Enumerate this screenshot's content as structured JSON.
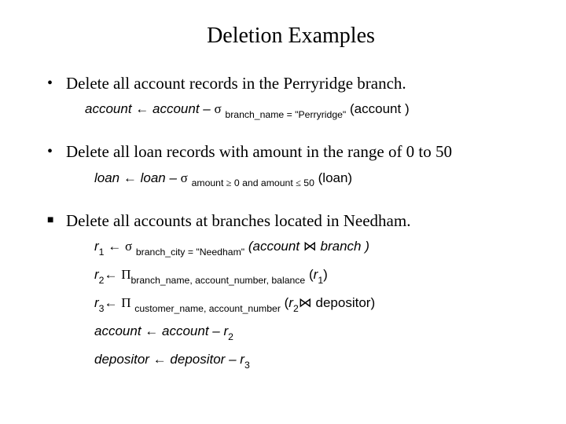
{
  "title": "Deletion Examples",
  "items": [
    {
      "bullet": "•",
      "text": "Delete all account records in the Perryridge branch.",
      "formula": {
        "lhs": "account",
        "arrow": "←",
        "rhs_a": "account –",
        "sigma": "σ",
        "sub": "branch_name = \"Perryridge\"",
        "tail": "(account )"
      }
    },
    {
      "bullet": "•",
      "text": "Delete all loan records with amount in the range of 0 to 50",
      "formula": {
        "lhs": "loan",
        "arrow": "←",
        "rhs_a": "loan –",
        "sigma": "σ",
        "sub_a": "amount",
        "ge": "≥",
        "sub_b": "0 and amount",
        "le": "≤",
        "sub_c": "50",
        "tail": "(loan)"
      }
    },
    {
      "bullet": "■",
      "text": "Delete all accounts at branches located in Needham.",
      "lines": {
        "l1": {
          "r": "r",
          "n": "1",
          "arrow": "←",
          "sigma": "σ",
          "sub": "branch_city = \"Needham\"",
          "open": "(account",
          "join": "⋈",
          "close": "branch )"
        },
        "l2": {
          "r": "r",
          "n": "2",
          "arrow": "←",
          "pi": "Π",
          "sub": "branch_name, account_number, balance",
          "open": "(",
          "r2": "r",
          "n2": "1",
          "close": ")"
        },
        "l3": {
          "r": "r",
          "n": "3",
          "arrow": "←",
          "pi": "Π",
          "sub": "customer_name, account_number",
          "open": "(",
          "r2": "r",
          "n2": "2",
          "join": "⋈",
          "dep": "depositor)",
          "close": ""
        },
        "l4": {
          "a": "account",
          "arrow": "←",
          "b": "account –",
          "r": "r",
          "n": "2"
        },
        "l5": {
          "a": "depositor",
          "arrow": "←",
          "b": "depositor –",
          "r": "r",
          "n": "3"
        }
      }
    }
  ]
}
